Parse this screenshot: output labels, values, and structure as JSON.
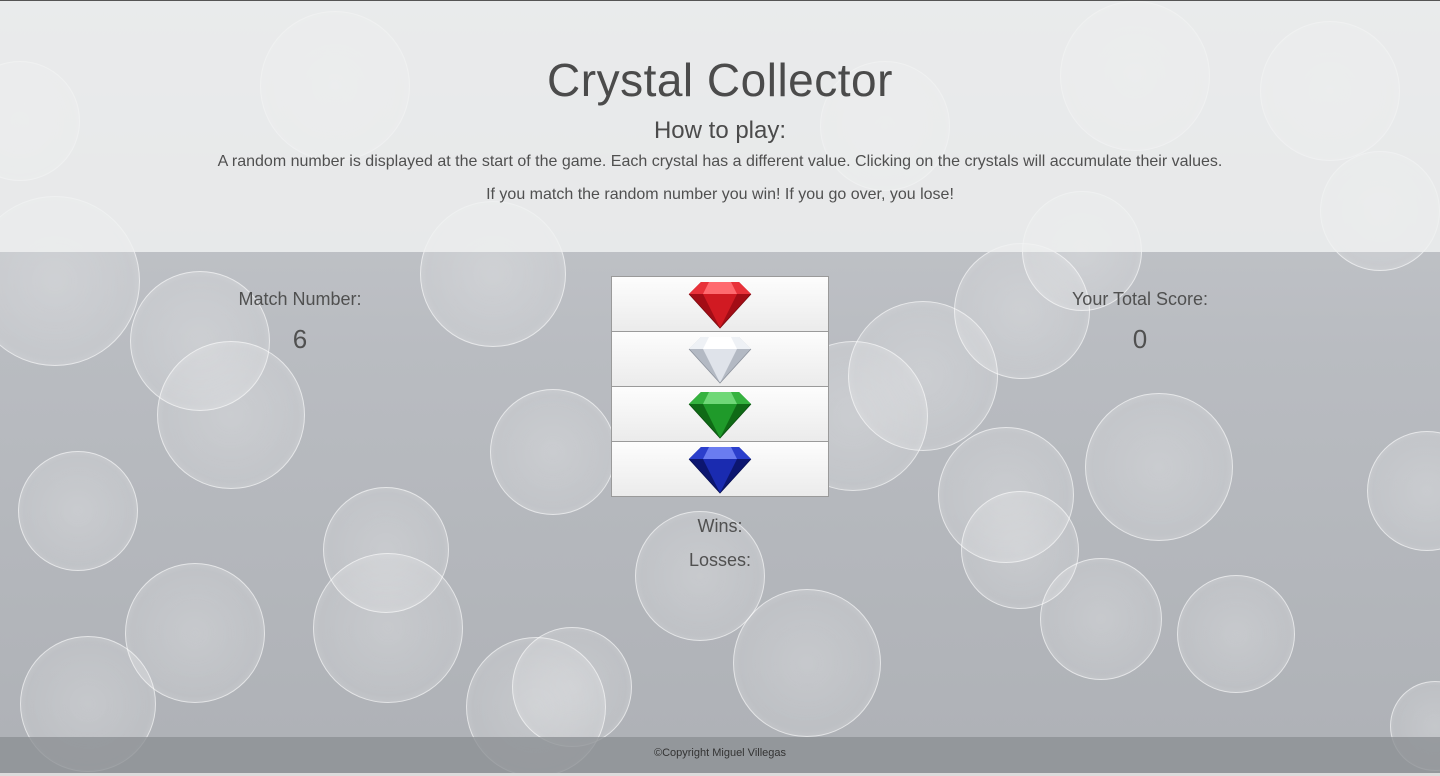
{
  "header": {
    "title": "Crystal Collector",
    "subtitle": "How to play:",
    "instructions_1": "A random number is displayed at the start of the game. Each crystal has a different value. Clicking on the crystals will accumulate their values.",
    "instructions_2": "If you match the random number you win! If you go over, you lose!"
  },
  "match": {
    "label": "Match Number:",
    "value": "6"
  },
  "score": {
    "label": "Your Total Score:",
    "value": "0"
  },
  "crystals": [
    {
      "icon": "red-crystal-icon",
      "color": "#d11a1a"
    },
    {
      "icon": "white-crystal-icon",
      "color": "#e6e9ee"
    },
    {
      "icon": "green-crystal-icon",
      "color": "#1f9a2a"
    },
    {
      "icon": "blue-crystal-icon",
      "color": "#1a2bb0"
    }
  ],
  "stats": {
    "wins_label": "Wins:",
    "losses_label": "Losses:"
  },
  "footer": {
    "text": "©Copyright Miguel Villegas"
  }
}
